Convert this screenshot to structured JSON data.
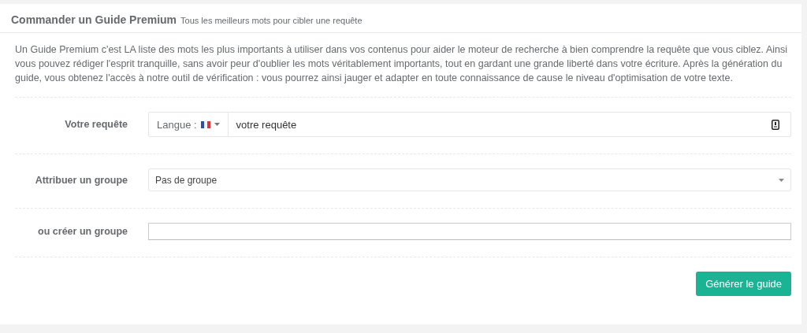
{
  "panel": {
    "title": "Commander un Guide Premium",
    "subtitle": "Tous les meilleurs mots pour cibler une requête"
  },
  "intro": "Un Guide Premium c'est LA liste des mots les plus importants à utiliser dans vos contenus pour aider le moteur de recherche à bien comprendre la requête que vous ciblez. Ainsi vous pouvez rédiger l'esprit tranquille, sans avoir peur d'oublier les mots véritablement importants, tout en gardant une grande liberté dans votre écriture. Après la génération du guide, vous obtenez l'accès à notre outil de vérification : vous pourrez ainsi jauger et adapter en toute connaissance de cause le niveau d'optimisation de votre texte.",
  "form_rows": [
    {
      "kind": "query",
      "label": "Votre requête",
      "addon": "Langue :",
      "value": "votre requête"
    },
    {
      "kind": "select",
      "label": "Attribuer un groupe",
      "value": "Pas de groupe"
    },
    {
      "kind": "input",
      "label": "ou créer un groupe"
    }
  ],
  "submit": "Générer le guide"
}
